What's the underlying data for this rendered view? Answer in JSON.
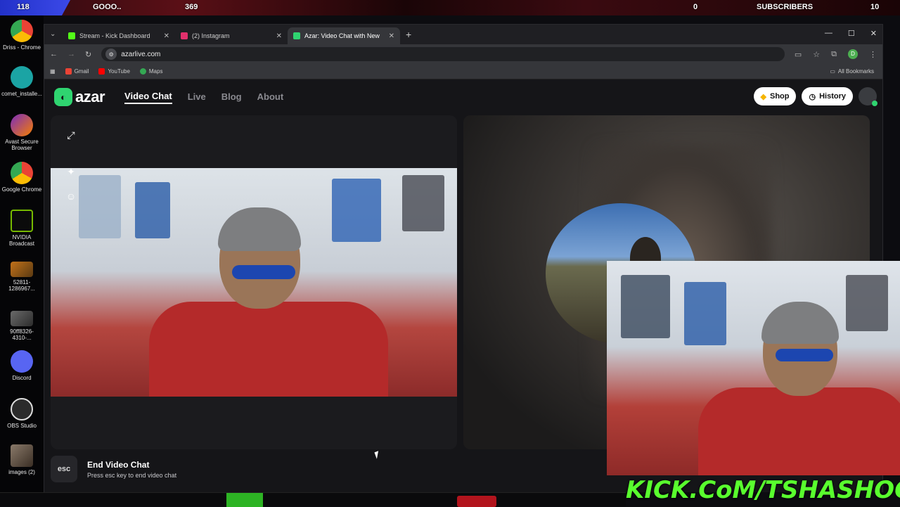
{
  "overlay": {
    "left_count": "118",
    "goal_label": "GOOO..",
    "goal_count": "369",
    "sub_count_left": "0",
    "subscribers_label": "SUBSCRIBERS",
    "sub_count_right": "10"
  },
  "desktop": {
    "icons": [
      {
        "label": "Driss - Chrome",
        "icon": "chrome-icon"
      },
      {
        "label": "comet_installe...",
        "icon": "comet-icon"
      },
      {
        "label": "Avast Secure Browser",
        "icon": "avast-icon"
      },
      {
        "label": "Google Chrome",
        "icon": "chrome-icon"
      },
      {
        "label": "NVIDIA Broadcast",
        "icon": "nvidia-icon"
      },
      {
        "label": "52811-1286967...",
        "icon": "image-file-icon"
      },
      {
        "label": "90ff8326-4310-...",
        "icon": "image-file-icon"
      },
      {
        "label": "Discord",
        "icon": "discord-icon"
      },
      {
        "label": "OBS Studio",
        "icon": "obs-icon"
      },
      {
        "label": "images (2)",
        "icon": "image-file-icon"
      }
    ]
  },
  "browser": {
    "tabs": [
      {
        "label": "Stream - Kick Dashboard",
        "color": "#53fc18"
      },
      {
        "label": "(2) Instagram",
        "color": "#e1306c"
      },
      {
        "label": "Azar: Video Chat with New",
        "color": "#2fd470"
      }
    ],
    "url": "azarlive.com",
    "profile_initial": "D",
    "bookmarks": [
      {
        "label": "Gmail",
        "color": "#ea4335"
      },
      {
        "label": "YouTube",
        "color": "#ff0000"
      },
      {
        "label": "Maps",
        "color": "#34a853"
      }
    ],
    "all_bookmarks": "All Bookmarks"
  },
  "azar": {
    "logo": "azar",
    "nav": [
      "Video Chat",
      "Live",
      "Blog",
      "About"
    ],
    "shop_label": "Shop",
    "history_label": "History",
    "end_key": "esc",
    "end_title": "End Video Chat",
    "end_sub": "Press esc key to end video chat"
  },
  "stream": {
    "kick_url": "KICK.CoM/TSHASHOO"
  },
  "colors": {
    "accent": "#2fd470",
    "kick_green": "#59ff2e"
  }
}
